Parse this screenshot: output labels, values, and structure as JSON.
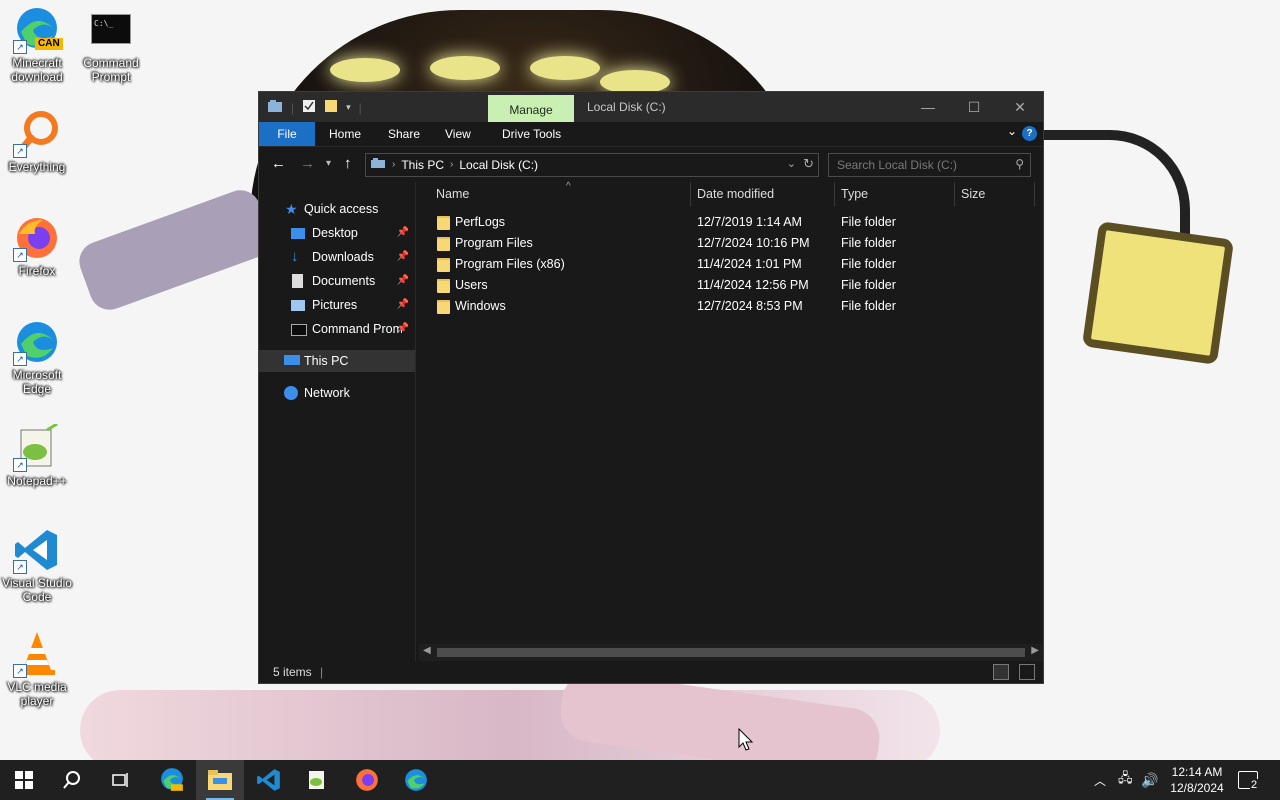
{
  "desktop": {
    "icons": [
      {
        "label": "Minecraft download",
        "badge": "CAN"
      },
      {
        "label": "Command Prompt",
        "glyph": "C:\\_"
      },
      {
        "label": "Everything"
      },
      {
        "label": "Firefox"
      },
      {
        "label": "Microsoft Edge"
      },
      {
        "label": "Notepad++"
      },
      {
        "label": "Visual Studio Code"
      },
      {
        "label": "VLC media player"
      }
    ]
  },
  "window": {
    "title": "Local Disk (C:)",
    "manage_tab": "Manage",
    "controls": {
      "minimize": "—",
      "maximize": "☐",
      "close": "✕"
    },
    "ribbon_tabs": [
      "File",
      "Home",
      "Share",
      "View",
      "Drive Tools"
    ],
    "help_label": "?",
    "address": {
      "crumbs": [
        "This PC",
        "Local Disk (C:)"
      ]
    },
    "search_placeholder": "Search Local Disk (C:)",
    "nav_pane": [
      {
        "label": "Quick access",
        "icon": "star-icon"
      },
      {
        "label": "Desktop",
        "icon": "desktop-icon",
        "pinned": true
      },
      {
        "label": "Downloads",
        "icon": "download-icon",
        "pinned": true
      },
      {
        "label": "Documents",
        "icon": "document-icon",
        "pinned": true
      },
      {
        "label": "Pictures",
        "icon": "picture-icon",
        "pinned": true
      },
      {
        "label": "Command Prom",
        "icon": "terminal-icon",
        "pinned": true
      },
      {
        "label": "This PC",
        "icon": "computer-icon",
        "selected": true
      },
      {
        "label": "Network",
        "icon": "network-icon"
      }
    ],
    "columns": [
      "Name",
      "Date modified",
      "Type",
      "Size"
    ],
    "files": [
      {
        "name": "PerfLogs",
        "date": "12/7/2019 1:14 AM",
        "type": "File folder",
        "size": ""
      },
      {
        "name": "Program Files",
        "date": "12/7/2024 10:16 PM",
        "type": "File folder",
        "size": ""
      },
      {
        "name": "Program Files (x86)",
        "date": "11/4/2024 1:01 PM",
        "type": "File folder",
        "size": ""
      },
      {
        "name": "Users",
        "date": "11/4/2024 12:56 PM",
        "type": "File folder",
        "size": ""
      },
      {
        "name": "Windows",
        "date": "12/7/2024 8:53 PM",
        "type": "File folder",
        "size": ""
      }
    ],
    "status": "5 items"
  },
  "taskbar": {
    "time": "12:14 AM",
    "date": "12/8/2024",
    "notifications": "2",
    "pinned": [
      "start-icon",
      "search-icon",
      "task-view-icon",
      "edge-can-icon",
      "file-explorer-icon",
      "vscode-icon",
      "notepad-plus-icon",
      "firefox-icon",
      "edge-icon"
    ]
  },
  "colors": {
    "accent": "#1b6fc4",
    "manage_tab": "#c9efb2",
    "folder": "#f8d775",
    "window_bg": "#191919",
    "taskbar_bg": "#202020"
  }
}
